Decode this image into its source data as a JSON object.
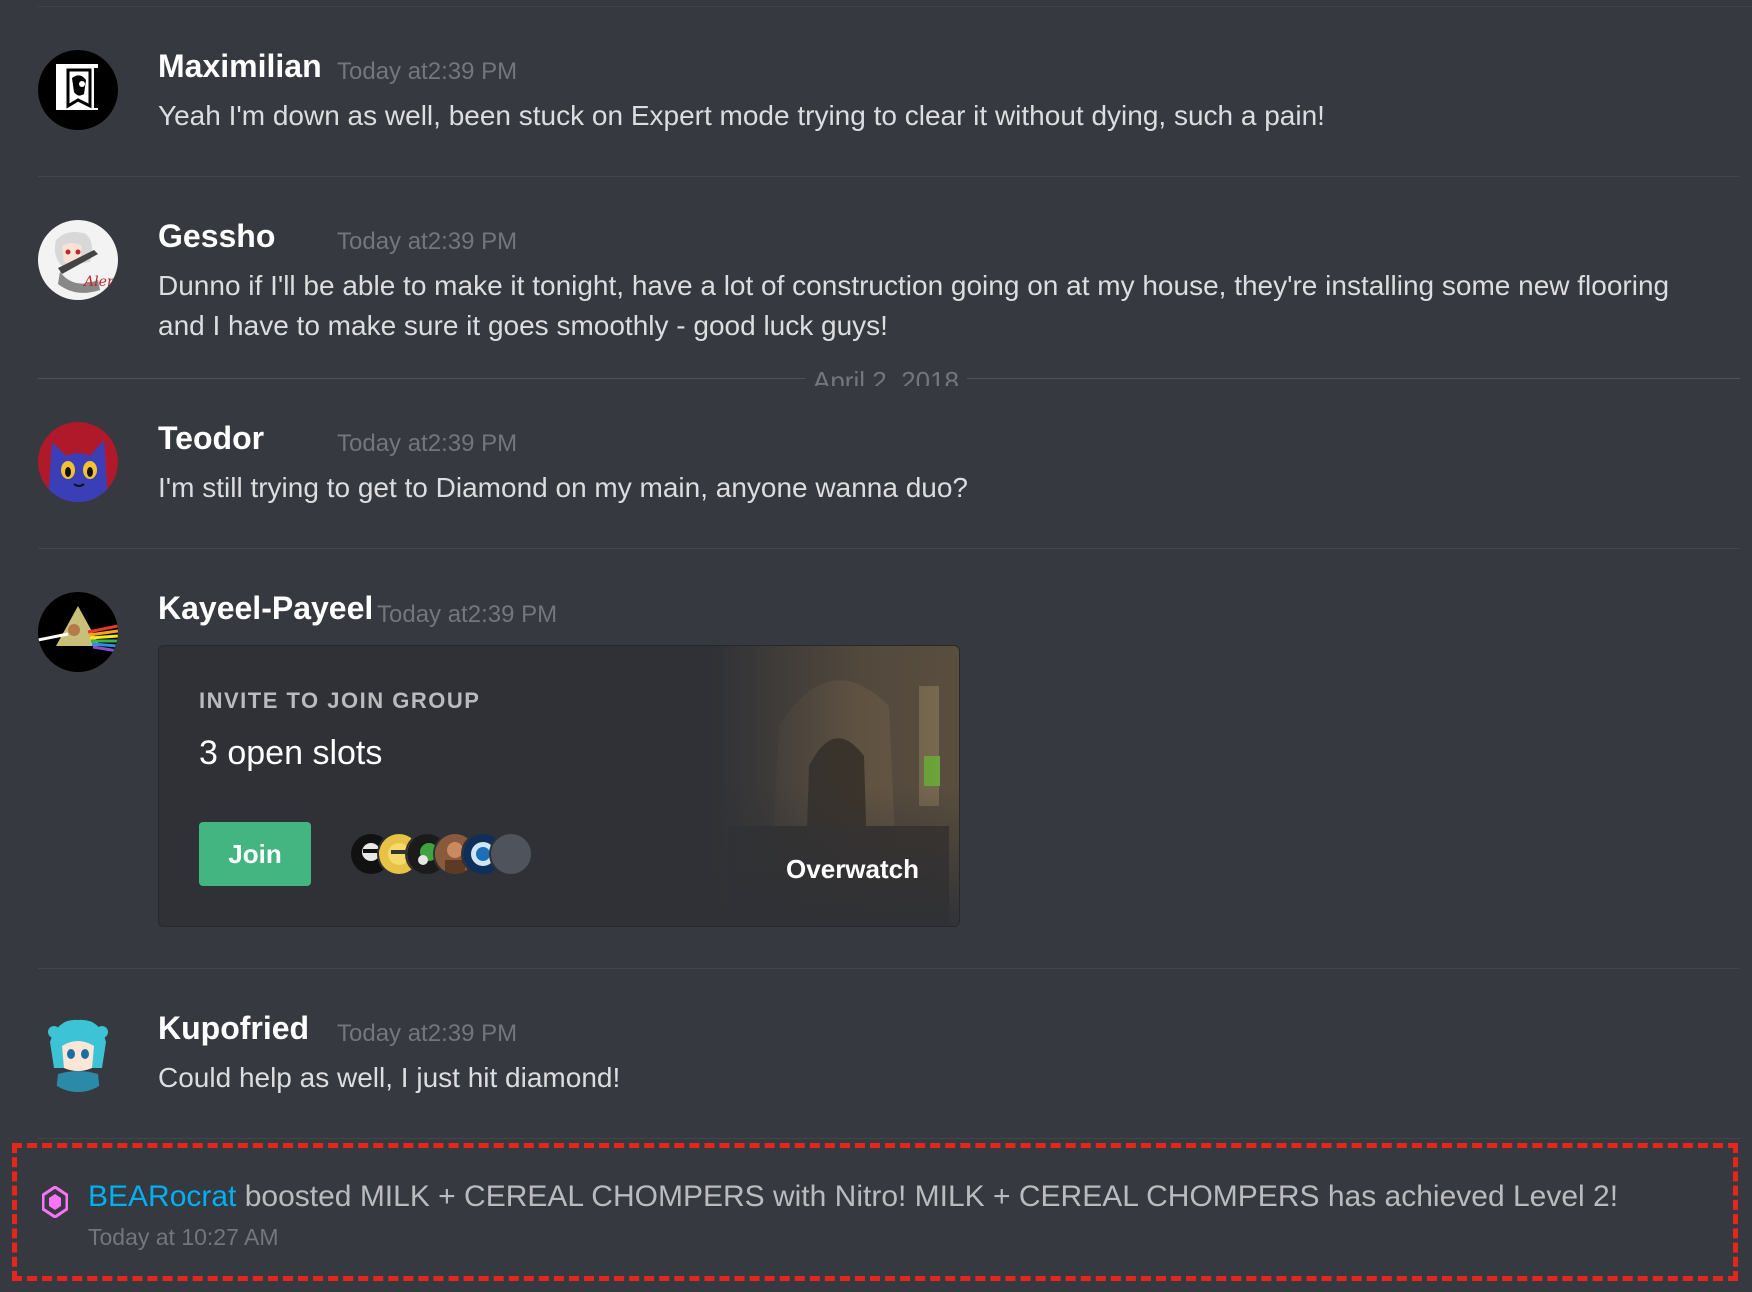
{
  "messages": [
    {
      "username": "Maximilian",
      "timestamp": "Today at2:39 PM",
      "text": "Yeah I'm down as well, been stuck on Expert mode trying to clear it without dying, such a pain!"
    },
    {
      "username": "Gessho",
      "timestamp": "Today at2:39 PM",
      "text": "Dunno if I'll be able to make it tonight, have a lot of construction going on at my house, they're installing some new flooring and I have to make sure it goes smoothly - good luck guys!"
    },
    {
      "username": "Teodor",
      "timestamp": "Today at2:39 PM",
      "text": "I'm still trying to get to Diamond on my main, anyone wanna duo?"
    },
    {
      "username": "Kayeel-Payeel",
      "timestamp": "Today at2:39 PM"
    },
    {
      "username": "Kupofried",
      "timestamp": "Today at2:39 PM",
      "text": "Could help as well, I just hit diamond!"
    }
  ],
  "date_separator": "April 2, 2018",
  "invite": {
    "title": "INVITE TO JOIN GROUP",
    "slots": "3 open slots",
    "join_label": "Join",
    "game": "Overwatch"
  },
  "boost": {
    "user": "BEARocrat",
    "text": " boosted MILK + CEREAL CHOMPERS with Nitro! MILK + CEREAL CHOMPERS has achieved Level 2!",
    "timestamp": "Today at 10:27 AM",
    "icon": "nitro-boost-gem-icon"
  },
  "colors": {
    "background": "#36393f",
    "join_button": "#43b581",
    "boost_user": "#00aff4",
    "boost_icon": "#ff73fa",
    "highlight_border": "#e5261b"
  }
}
